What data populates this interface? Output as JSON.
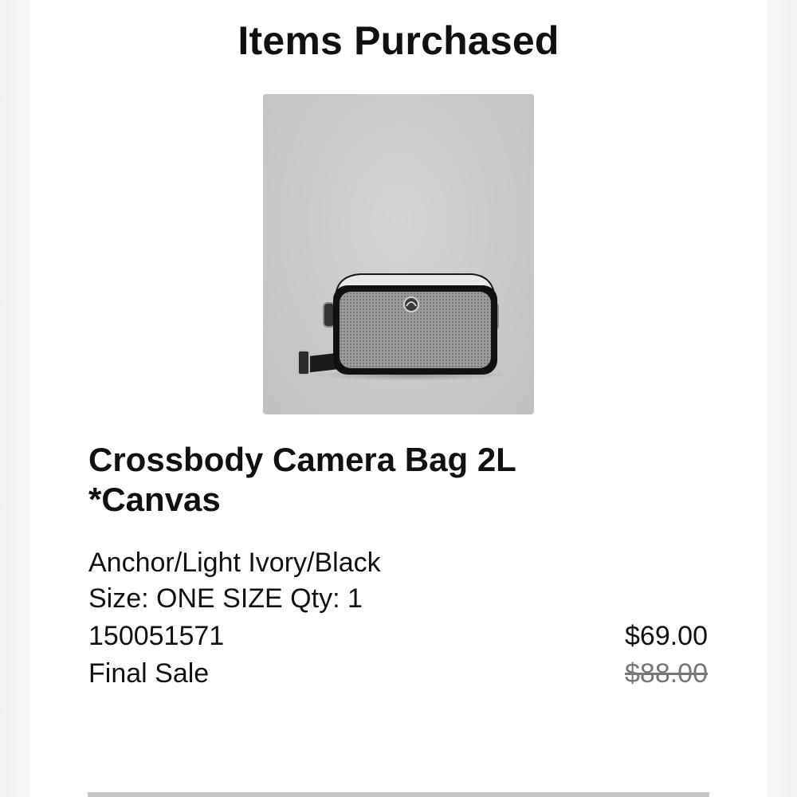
{
  "header": {
    "title": "Items Purchased"
  },
  "item": {
    "name_line1": "Crossbody Camera Bag 2L",
    "name_line2": "*Canvas",
    "color": "Anchor/Light Ivory/Black",
    "size_qty": "Size: ONE SIZE Qty: 1",
    "sku": "150051571",
    "sale_status": "Final Sale",
    "price": "$69.00",
    "original_price": "$88.00"
  },
  "colors": {
    "price_strikethrough": "#777777",
    "image_background": "#c9c9c7"
  }
}
